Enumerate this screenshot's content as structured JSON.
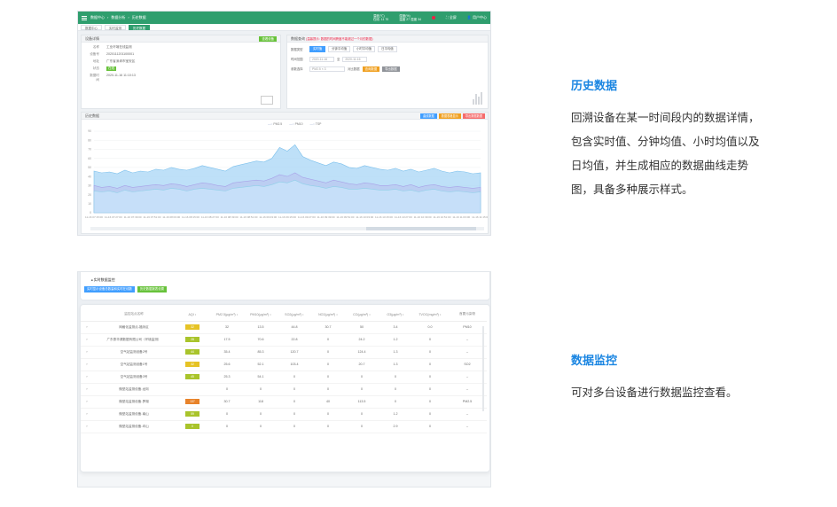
{
  "screenshot1": {
    "topbar": {
      "breadcrumb": [
        "数据中心",
        "数据分析",
        "历史数据"
      ],
      "stats": [
        {
          "label": "温度(℃)",
          "value": "在线: 11  70"
        },
        {
          "label": "湿度(%)",
          "value": "温度 27  湿度 34"
        }
      ],
      "fullscreen_label": "全屏",
      "user_label": "用户中心"
    },
    "tabs": [
      "数据中心",
      "实时监测",
      "历史数据"
    ],
    "info_panel": {
      "title": "设备详情",
      "action": "查看设备",
      "rows": [
        {
          "k": "名称",
          "v": "工业环境在线监测"
        },
        {
          "k": "设备号",
          "v": "2020111201100001"
        },
        {
          "k": "地址",
          "v": "广东省深圳市宝安区"
        },
        {
          "k": "状态",
          "v": "在线"
        },
        {
          "k": "数据时间",
          "v": "2020-11-16 11:10:13"
        }
      ]
    },
    "query_panel": {
      "title": "数据查询",
      "warning": "(温馨提示: 数据的时间跨度不能超过一个月的数据)",
      "type_label": "数据类型",
      "types": [
        "实时值",
        "分钟平均值",
        "小时平均值",
        "日平均值"
      ],
      "time_label": "时间范围",
      "start": "2020-11-16",
      "separator": "至",
      "end": "2020-11-16",
      "param_label": "参数选择",
      "param_value": "PM2.5  ×  3",
      "compare_label": "对比数据",
      "btn_query": "查询数据",
      "btn_export": "导出数据"
    },
    "chart_panel": {
      "title": "历史数据",
      "buttons": [
        "曲线数据",
        "数据表格显示",
        "导出数据数据"
      ],
      "legend": [
        "PM2.5",
        "PM10",
        "TSP"
      ]
    }
  },
  "chart_data": {
    "type": "area",
    "title": "",
    "ylim": [
      0,
      90
    ],
    "y_ticks": [
      0,
      10,
      20,
      30,
      40,
      50,
      60,
      70,
      80,
      90
    ],
    "x_ticks": [
      "11-16 07:15:00",
      "11-16 07:27:00",
      "11-16 07:39:00",
      "11-16 07:51:00",
      "11-16 08:03:00",
      "11-16 08:15:00",
      "11-16 08:27:00",
      "11-16 08:39:00",
      "11-16 08:51:00",
      "11-16 09:03:00",
      "11-16 09:15:00",
      "11-16 09:27:00",
      "11-16 09:39:00",
      "11-16 09:51:00",
      "11-16 10:03:00",
      "11-16 10:15:00",
      "11-16 10:27:00",
      "11-16 10:39:00",
      "11-16 10:51:00",
      "11-16 11:03:00",
      "11-16 11:15:00"
    ],
    "series": [
      {
        "name": "TSP",
        "values": [
          46,
          44,
          45,
          43,
          47,
          44,
          46,
          45,
          48,
          47,
          50,
          48,
          47,
          49,
          52,
          50,
          48,
          46,
          51,
          53,
          55,
          57,
          56,
          60,
          72,
          68,
          75,
          62,
          58,
          55,
          52,
          56,
          54,
          50,
          49,
          52,
          50,
          48,
          47,
          49,
          46,
          48,
          45,
          47,
          49,
          46,
          44,
          46,
          45,
          43,
          44
        ]
      },
      {
        "name": "PM10",
        "values": [
          30,
          28,
          29,
          27,
          30,
          28,
          29,
          30,
          31,
          30,
          32,
          31,
          29,
          31,
          33,
          32,
          30,
          29,
          33,
          34,
          35,
          36,
          35,
          38,
          42,
          40,
          44,
          39,
          37,
          35,
          33,
          36,
          34,
          32,
          31,
          33,
          32,
          30,
          30,
          31,
          29,
          31,
          28,
          30,
          31,
          29,
          28,
          29,
          28,
          27,
          28
        ]
      },
      {
        "name": "PM2.5",
        "values": [
          24,
          23,
          24,
          22,
          25,
          23,
          24,
          25,
          26,
          25,
          27,
          26,
          24,
          26,
          27,
          26,
          25,
          24,
          27,
          28,
          29,
          30,
          29,
          31,
          34,
          33,
          36,
          32,
          30,
          29,
          27,
          29,
          28,
          26,
          26,
          27,
          26,
          25,
          25,
          26,
          24,
          25,
          23,
          25,
          26,
          24,
          23,
          24,
          23,
          22,
          23
        ]
      }
    ]
  },
  "screenshot2": {
    "title": "实时数据监控",
    "buttons": [
      "实时显示设备总数量和实时在线数",
      "历史数据报表设置"
    ],
    "columns": [
      "监控站点名称",
      "AQI ↕",
      "PM2.5(μg/m³) ↕",
      "PM10(μg/m³) ↕",
      "SO2(μg/m³) ↕",
      "NO2(μg/m³) ↕",
      "CO(μg/m³) ↕",
      "O3(μg/m³) ↕",
      "TVOC(mg/m³) ↕",
      "首要污染物"
    ],
    "rows": [
      {
        "name": "网格化监测点-福永区",
        "aqi": "32",
        "aqi_color": "#e6c325",
        "vals": [
          "32",
          "13.5",
          "44.8",
          "30.7",
          "50",
          "3.4",
          "0.0",
          "PM10"
        ]
      },
      {
        "name": "广东泰华源数据有限公司（环境监测）",
        "aqi": "28",
        "aqi_color": "#a9c42b",
        "vals": [
          "17.5",
          "70.6",
          "22.8",
          "0",
          "24.2",
          "1.2",
          "0",
          "--"
        ]
      },
      {
        "name": "空气站监测设备2号",
        "aqi": "44",
        "aqi_color": "#a9c42b",
        "vals": [
          "35.4",
          "85.3",
          "120.7",
          "0",
          "124.4",
          "1.3",
          "0",
          "--"
        ]
      },
      {
        "name": "空气站监测设备1号",
        "aqi": "32",
        "aqi_color": "#e6c325",
        "vals": [
          "25.6",
          "52.1",
          "103.4",
          "0",
          "20.7",
          "1.3",
          "0",
          "SO2"
        ]
      },
      {
        "name": "空气站监测设备3号",
        "aqi": "45",
        "aqi_color": "#a9c42b",
        "vals": [
          "25.3",
          "54.1",
          "0",
          "0",
          "0",
          "0",
          "0",
          "--"
        ]
      },
      {
        "name": "微型站监测设备-龙岗",
        "aqi": "",
        "aqi_color": "",
        "vals": [
          "0",
          "0",
          "0",
          "0",
          "0",
          "0",
          "0",
          "--"
        ]
      },
      {
        "name": "微型站监测设备-罗湖",
        "aqi": "137",
        "aqi_color": "#e8832a",
        "vals": [
          "30.7",
          "118",
          "0",
          "40",
          "113.5",
          "0",
          "0",
          "PM2.5"
        ]
      },
      {
        "name": "微型站监测设备-南山",
        "aqi": "59",
        "aqi_color": "#a9c42b",
        "vals": [
          "0",
          "0",
          "0",
          "0",
          "0",
          "1.2",
          "0",
          "--"
        ]
      },
      {
        "name": "微型站监测设备-坪山",
        "aqi": "0",
        "aqi_color": "#a9c42b",
        "vals": [
          "0",
          "0",
          "0",
          "0",
          "0",
          "2.9",
          "0",
          "--"
        ]
      }
    ]
  },
  "sections": [
    {
      "title": "历史数据",
      "desc": "回溯设备在某一时间段内的数据详情，包含实时值、分钟均值、小时均值以及日均值，并生成相应的数据曲线走势图，具备多种展示样式。"
    },
    {
      "title": "数据监控",
      "desc": "可对多台设备进行数据监控查看。"
    }
  ]
}
